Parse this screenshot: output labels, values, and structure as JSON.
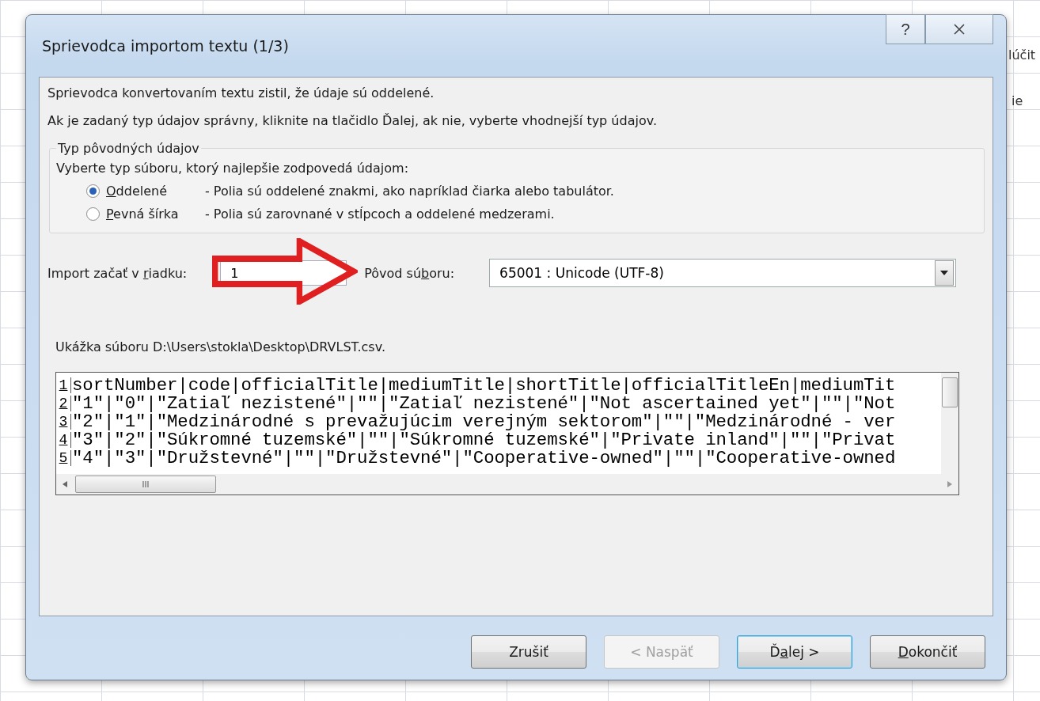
{
  "background": {
    "fragments": [
      "lúčit",
      "ie"
    ]
  },
  "window": {
    "title": "Sprievodca importom textu (1/3)",
    "help": "?"
  },
  "intro": [
    "Sprievodca konvertovaním textu zistil, že údaje sú oddelené.",
    "Ak je zadaný typ údajov správny, kliknite na tlačidlo Ďalej, ak nie, vyberte vhodnejší typ údajov."
  ],
  "data_type": {
    "legend": "Typ pôvodných údajov",
    "prompt": "Vyberte typ súboru, ktorý najlepšie zodpovedá údajom:",
    "options": [
      {
        "label": {
          "key": "O",
          "after": "ddelené"
        },
        "description": "- Polia sú oddelené znakmi, ako napríklad čiarka alebo tabulátor.",
        "selected": true
      },
      {
        "label": {
          "key": "P",
          "after": "evná šírka"
        },
        "description": "- Polia sú zarovnané v stĺpcoch a oddelené medzerami.",
        "selected": false
      }
    ]
  },
  "start_row": {
    "label": {
      "before": "Import začať v ",
      "key": "r",
      "after": "iadku:"
    },
    "value": "1"
  },
  "origin": {
    "label": {
      "before": "Pôvod sú",
      "key": "b",
      "after": "oru:"
    },
    "value": "65001 : Unicode (UTF-8)"
  },
  "preview": {
    "title": "Ukážka súboru D:\\Users\\stokla\\Desktop\\DRVLST.csv.",
    "lines": [
      {
        "number": "1",
        "text": "sortNumber|code|officialTitle|mediumTitle|shortTitle|officialTitleEn|mediumTit"
      },
      {
        "number": "2",
        "text": "\"1\"|\"0\"|\"Zatiaľ nezistené\"|\"\"|\"Zatiaľ nezistené\"|\"Not ascertained yet\"|\"\"|\"Not"
      },
      {
        "number": "3",
        "text": "\"2\"|\"1\"|\"Medzinárodné s prevažujúcim verejným sektorom\"|\"\"|\"Medzinárodné - ver"
      },
      {
        "number": "4",
        "text": "\"3\"|\"2\"|\"Súkromné tuzemské\"|\"\"|\"Súkromné tuzemské\"|\"Private inland\"|\"\"|\"Privat"
      },
      {
        "number": "5",
        "text": "\"4\"|\"3\"|\"Družstevné\"|\"\"|\"Družstevné\"|\"Cooperative-owned\"|\"\"|\"Cooperative-owned"
      }
    ],
    "hscroll_mark": "III"
  },
  "buttons": [
    {
      "label": {
        "before": "Zrušiť"
      },
      "disabled": false,
      "default": false
    },
    {
      "label": {
        "before": "< Naspäť"
      },
      "disabled": true,
      "default": false
    },
    {
      "label": {
        "before": "Ď",
        "key": "a",
        "after": "lej >"
      },
      "disabled": false,
      "default": true
    },
    {
      "label": {
        "key": "D",
        "after": "okončiť"
      },
      "disabled": false,
      "default": false
    }
  ]
}
